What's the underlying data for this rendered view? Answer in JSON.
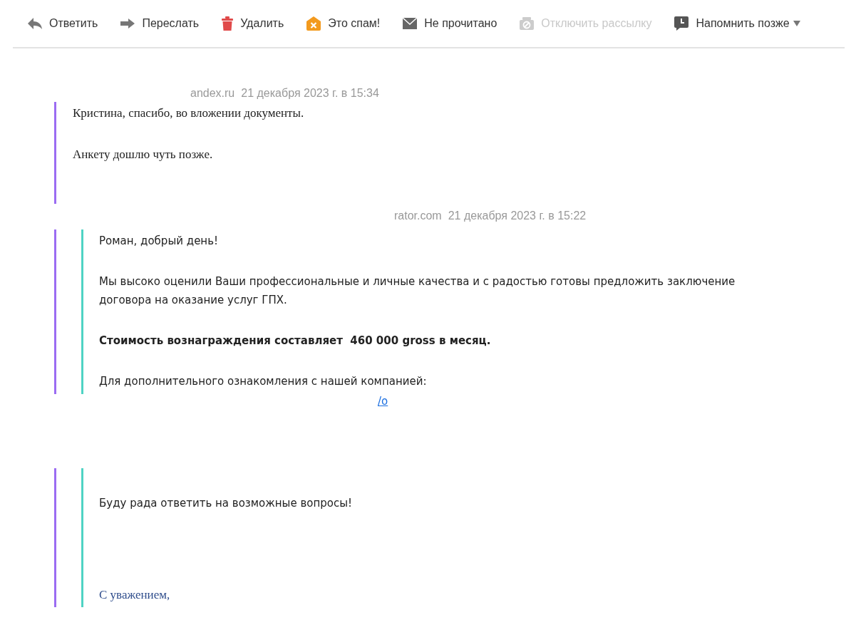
{
  "toolbar": [
    {
      "kind": "reply",
      "label": "Ответить",
      "disabled": false
    },
    {
      "kind": "forward",
      "label": "Переслать",
      "disabled": false
    },
    {
      "kind": "delete",
      "label": "Удалить",
      "disabled": false
    },
    {
      "kind": "spam",
      "label": "Это спам!",
      "disabled": false
    },
    {
      "kind": "unread",
      "label": "Не прочитано",
      "disabled": false
    },
    {
      "kind": "unsubscribe",
      "label": "Отключить рассылку",
      "disabled": true
    },
    {
      "kind": "remind",
      "label": "Напомнить позже",
      "disabled": false,
      "dropdown": true
    }
  ],
  "messages": [
    {
      "sender": "andex.ru",
      "date": "21 декабря 2023 г. в 15:34",
      "parts": [
        {
          "kind": "own",
          "paragraphs": [
            "Кристина, спасибо, во вложении документы.",
            "Анкету дошлю чуть позже."
          ]
        }
      ]
    },
    {
      "sender": "rator.com",
      "date": "21 декабря 2023 г. в 15:22",
      "parts": [
        {
          "kind": "quote",
          "blocks": [
            {
              "kind": "text",
              "text": "Роман, добрый день!"
            },
            {
              "kind": "text",
              "text": "Мы высоко оценили Ваши профессиональные и личные качества и с радостью готовы предложить заключение договора на оказание услуг ГПХ."
            },
            {
              "kind": "bold",
              "text": "Стоимость вознаграждения составляет  460 000 gross в месяц."
            },
            {
              "kind": "text",
              "text": "Для дополнительного ознакомления с нашей компанией:"
            }
          ]
        },
        {
          "kind": "link",
          "text": "/o"
        },
        {
          "kind": "quote",
          "blocks": [
            {
              "kind": "text",
              "text": "Буду рада ответить на возможные вопросы!"
            },
            {
              "kind": "signature",
              "text": "С уважением,"
            }
          ]
        }
      ]
    }
  ]
}
